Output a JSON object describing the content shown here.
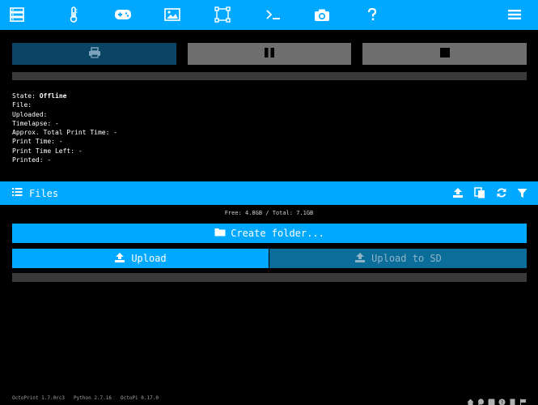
{
  "nav": {
    "items": [
      "state",
      "temperature",
      "control",
      "timelapse",
      "gcode-viewer",
      "terminal",
      "webcam",
      "about",
      "menu"
    ]
  },
  "controls": {
    "print_label": "",
    "pause_label": "",
    "cancel_label": ""
  },
  "state": {
    "state_label": "State:",
    "state_value": "Offline",
    "file_label": "File:",
    "file_value": "",
    "uploaded_label": "Uploaded:",
    "uploaded_value": "",
    "timelapse_label": "Timelapse:",
    "timelapse_value": "-",
    "approx_label": "Approx. Total Print Time:",
    "approx_value": "-",
    "print_time_label": "Print Time:",
    "print_time_value": "-",
    "print_time_left_label": "Print Time Left:",
    "print_time_left_value": "-",
    "printed_label": "Printed:",
    "printed_value": "-",
    "progress": 0
  },
  "files": {
    "title": "Files",
    "free_space": "Free: 4.8GB / Total: 7.1GB",
    "create_folder_label": "Create folder...",
    "upload_label": "Upload",
    "upload_sd_label": "Upload to SD",
    "upload_progress": 0
  },
  "footer": {
    "octoprint_version": "OctoPrint 1.7.0rc3",
    "python_version": "Python 2.7.16",
    "octopi_version": "OctoPi 0.17.0"
  },
  "colors": {
    "accent": "#00a8ff",
    "background": "#000000",
    "disabled_button": "#6e6e6e",
    "dark_accent": "#0b4566"
  }
}
